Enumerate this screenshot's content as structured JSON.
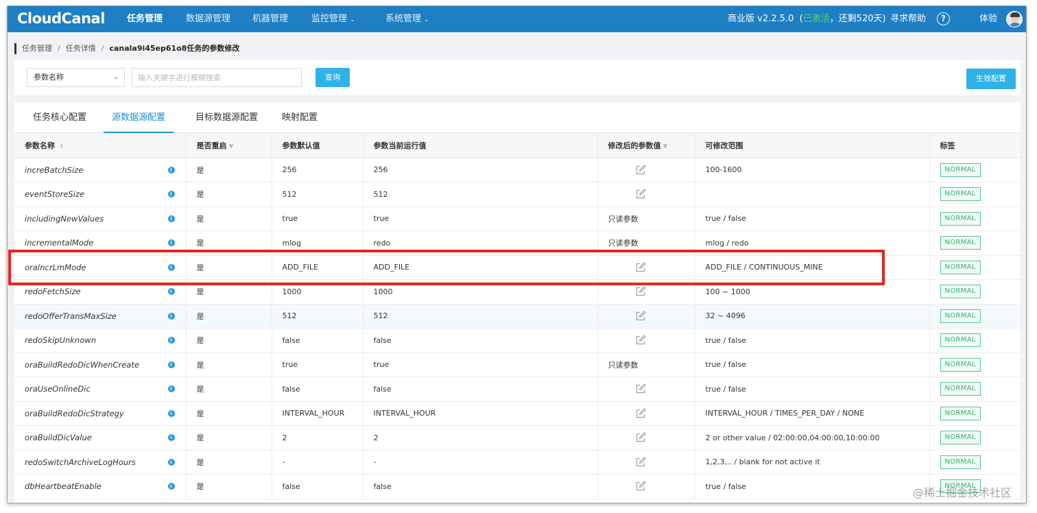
{
  "header": {
    "logo": "CloudCanal",
    "nav": [
      {
        "label": "任务管理",
        "active": true,
        "dropdown": false
      },
      {
        "label": "数据源管理",
        "active": false,
        "dropdown": false
      },
      {
        "label": "机器管理",
        "active": false,
        "dropdown": false
      },
      {
        "label": "监控管理",
        "active": false,
        "dropdown": true
      },
      {
        "label": "系统管理",
        "active": false,
        "dropdown": true
      }
    ],
    "version": "商业版 v2.2.5.0",
    "license_open": "(",
    "license_status": "已激活",
    "license_rest": "，还剩520天)",
    "help": "寻求帮助",
    "help_icon": "?",
    "user": "体验"
  },
  "breadcrumb": {
    "items": [
      "任务管理",
      "任务详情"
    ],
    "separator": "/",
    "current": "canala9i45ep61o8任务的参数修改"
  },
  "search": {
    "select_value": "参数名称",
    "placeholder": "输入关键字进行模糊搜索",
    "query_label": "查询",
    "apply_label": "生效配置"
  },
  "tabs": [
    "任务核心配置",
    "源数据源配置",
    "目标数据源配置",
    "映射配置"
  ],
  "active_tab": 1,
  "table": {
    "headers": [
      "参数名称",
      "是否重启",
      "参数默认值",
      "参数当前运行值",
      "修改后的参数值",
      "可修改范围",
      "标签"
    ],
    "rows": [
      {
        "name": "increBatchSize",
        "restart": "是",
        "default": "256",
        "current": "256",
        "modified": "",
        "range": "100-1600",
        "tag": "NORMAL"
      },
      {
        "name": "eventStoreSize",
        "restart": "是",
        "default": "512",
        "current": "512",
        "modified": "",
        "range": "",
        "tag": "NORMAL"
      },
      {
        "name": "includingNewValues",
        "restart": "是",
        "default": "true",
        "current": "true",
        "modified": "只读参数",
        "range": "true / false",
        "tag": "NORMAL"
      },
      {
        "name": "incrementalMode",
        "restart": "是",
        "default": "mlog",
        "current": "redo",
        "modified": "只读参数",
        "range": "mlog / redo",
        "tag": "NORMAL"
      },
      {
        "name": "oraIncrLmMode",
        "restart": "是",
        "default": "ADD_FILE",
        "current": "ADD_FILE",
        "modified": "",
        "range": "ADD_FILE / CONTINUOUS_MINE",
        "tag": "NORMAL"
      },
      {
        "name": "redoFetchSize",
        "restart": "是",
        "default": "1000",
        "current": "1000",
        "modified": "",
        "range": "100 ~ 1000",
        "tag": "NORMAL"
      },
      {
        "name": "redoOfferTransMaxSize",
        "restart": "是",
        "default": "512",
        "current": "512",
        "modified": "",
        "range": "32 ~ 4096",
        "tag": "NORMAL"
      },
      {
        "name": "redoSkipUnknown",
        "restart": "是",
        "default": "false",
        "current": "false",
        "modified": "",
        "range": "true / false",
        "tag": "NORMAL"
      },
      {
        "name": "oraBuildRedoDicWhenCreate",
        "restart": "是",
        "default": "true",
        "current": "true",
        "modified": "只读参数",
        "range": "true / false",
        "tag": "NORMAL"
      },
      {
        "name": "oraUseOnlineDic",
        "restart": "是",
        "default": "false",
        "current": "false",
        "modified": "",
        "range": "true / false",
        "tag": "NORMAL"
      },
      {
        "name": "oraBuildRedoDicStrategy",
        "restart": "是",
        "default": "INTERVAL_HOUR",
        "current": "INTERVAL_HOUR",
        "modified": "",
        "range": "INTERVAL_HOUR / TIMES_PER_DAY / NONE",
        "tag": "NORMAL"
      },
      {
        "name": "oraBuildDicValue",
        "restart": "是",
        "default": "2",
        "current": "2",
        "modified": "",
        "range": "2 or other value / 02:00:00,04:00:00,10:00:00",
        "tag": "NORMAL"
      },
      {
        "name": "redoSwitchArchiveLogHours",
        "restart": "是",
        "default": "-",
        "current": "-",
        "modified": "",
        "range": "1,2,3,.. / blank for not active it",
        "tag": "NORMAL"
      },
      {
        "name": "dbHeartbeatEnable",
        "restart": "是",
        "default": "false",
        "current": "false",
        "modified": "",
        "range": "true / false",
        "tag": "NORMAL"
      }
    ]
  },
  "info_glyph": "i",
  "highlight_row": 6,
  "watermark": "@稀土掘金技术社区",
  "colors": {
    "topbar": "#1e7fc5",
    "accent": "#2eb2e8",
    "active_tab": "#1e90d6",
    "tag_green": "#39b075",
    "annotation_red": "#e8231c",
    "license_green": "#52d36b"
  }
}
